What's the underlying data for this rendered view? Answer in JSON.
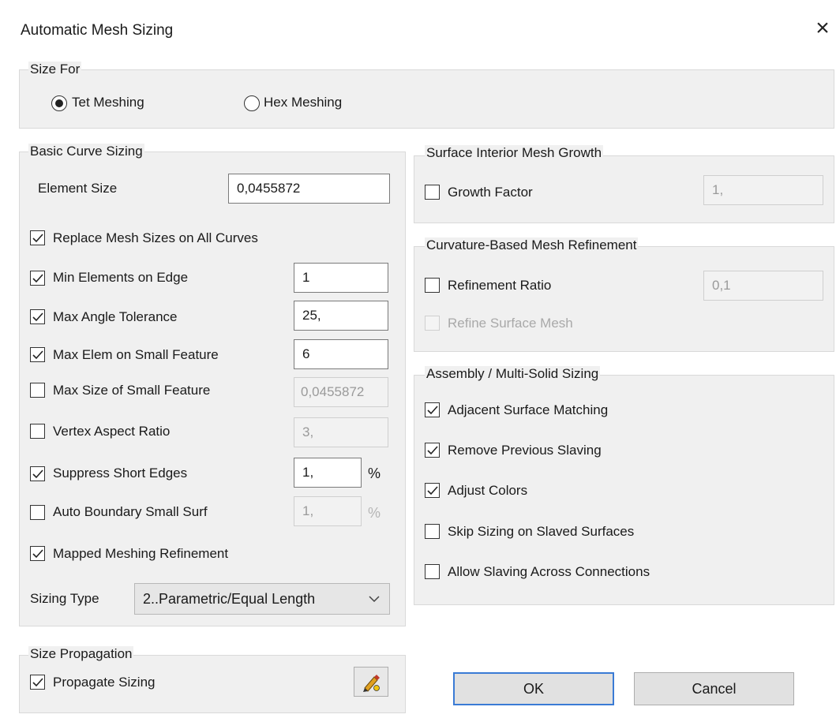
{
  "window": {
    "title": "Automatic Mesh Sizing",
    "close_glyph": "×"
  },
  "size_for": {
    "label": "Size For",
    "tet": {
      "label": "Tet Meshing",
      "selected": true
    },
    "hex": {
      "label": "Hex Meshing",
      "selected": false
    }
  },
  "basic_curve_sizing": {
    "label": "Basic Curve Sizing",
    "element_size": {
      "label": "Element Size",
      "value": "0,0455872"
    },
    "replace_mesh_sizes": {
      "label": "Replace Mesh Sizes on All Curves",
      "checked": true
    },
    "min_elements_on_edge": {
      "label": "Min Elements on Edge",
      "checked": true,
      "value": "1"
    },
    "max_angle_tolerance": {
      "label": "Max Angle Tolerance",
      "checked": true,
      "value": "25,"
    },
    "max_elem_small_feature": {
      "label": "Max Elem on Small Feature",
      "checked": true,
      "value": "6"
    },
    "max_size_small_feature": {
      "label": "Max Size of Small Feature",
      "checked": false,
      "value": "0,0455872"
    },
    "vertex_aspect_ratio": {
      "label": "Vertex Aspect Ratio",
      "checked": false,
      "value": "3,"
    },
    "suppress_short_edges": {
      "label": "Suppress Short Edges",
      "checked": true,
      "value": "1,",
      "unit": "%"
    },
    "auto_boundary_small_surf": {
      "label": "Auto Boundary Small Surf",
      "checked": false,
      "value": "1,",
      "unit": "%"
    },
    "mapped_meshing_refinement": {
      "label": "Mapped Meshing Refinement",
      "checked": true
    },
    "sizing_type": {
      "label": "Sizing Type",
      "value": "2..Parametric/Equal Length"
    }
  },
  "size_propagation": {
    "label": "Size Propagation",
    "propagate_sizing": {
      "label": "Propagate Sizing",
      "checked": true
    }
  },
  "surface_interior_growth": {
    "label": "Surface Interior Mesh Growth",
    "growth_factor": {
      "label": "Growth  Factor",
      "checked": false,
      "value": "1,"
    }
  },
  "curvature_refinement": {
    "label": "Curvature-Based Mesh Refinement",
    "refinement_ratio": {
      "label": "Refinement Ratio",
      "checked": false,
      "value": "0,1"
    },
    "refine_surface_mesh": {
      "label": "Refine Surface Mesh",
      "checked": false
    }
  },
  "assembly_sizing": {
    "label": "Assembly / Multi-Solid Sizing",
    "adjacent_surface_matching": {
      "label": "Adjacent Surface Matching",
      "checked": true
    },
    "remove_previous_slaving": {
      "label": "Remove Previous Slaving",
      "checked": true
    },
    "adjust_colors": {
      "label": "Adjust Colors",
      "checked": true
    },
    "skip_sizing_slaved": {
      "label": "Skip Sizing on Slaved Surfaces",
      "checked": false
    },
    "allow_slaving_connections": {
      "label": "Allow Slaving Across Connections",
      "checked": false
    }
  },
  "buttons": {
    "ok": "OK",
    "cancel": "Cancel"
  },
  "icons": {
    "propagate": "pencil-brush-icon",
    "checkmark": "check-icon",
    "dropdown": "chevron-down-icon"
  }
}
